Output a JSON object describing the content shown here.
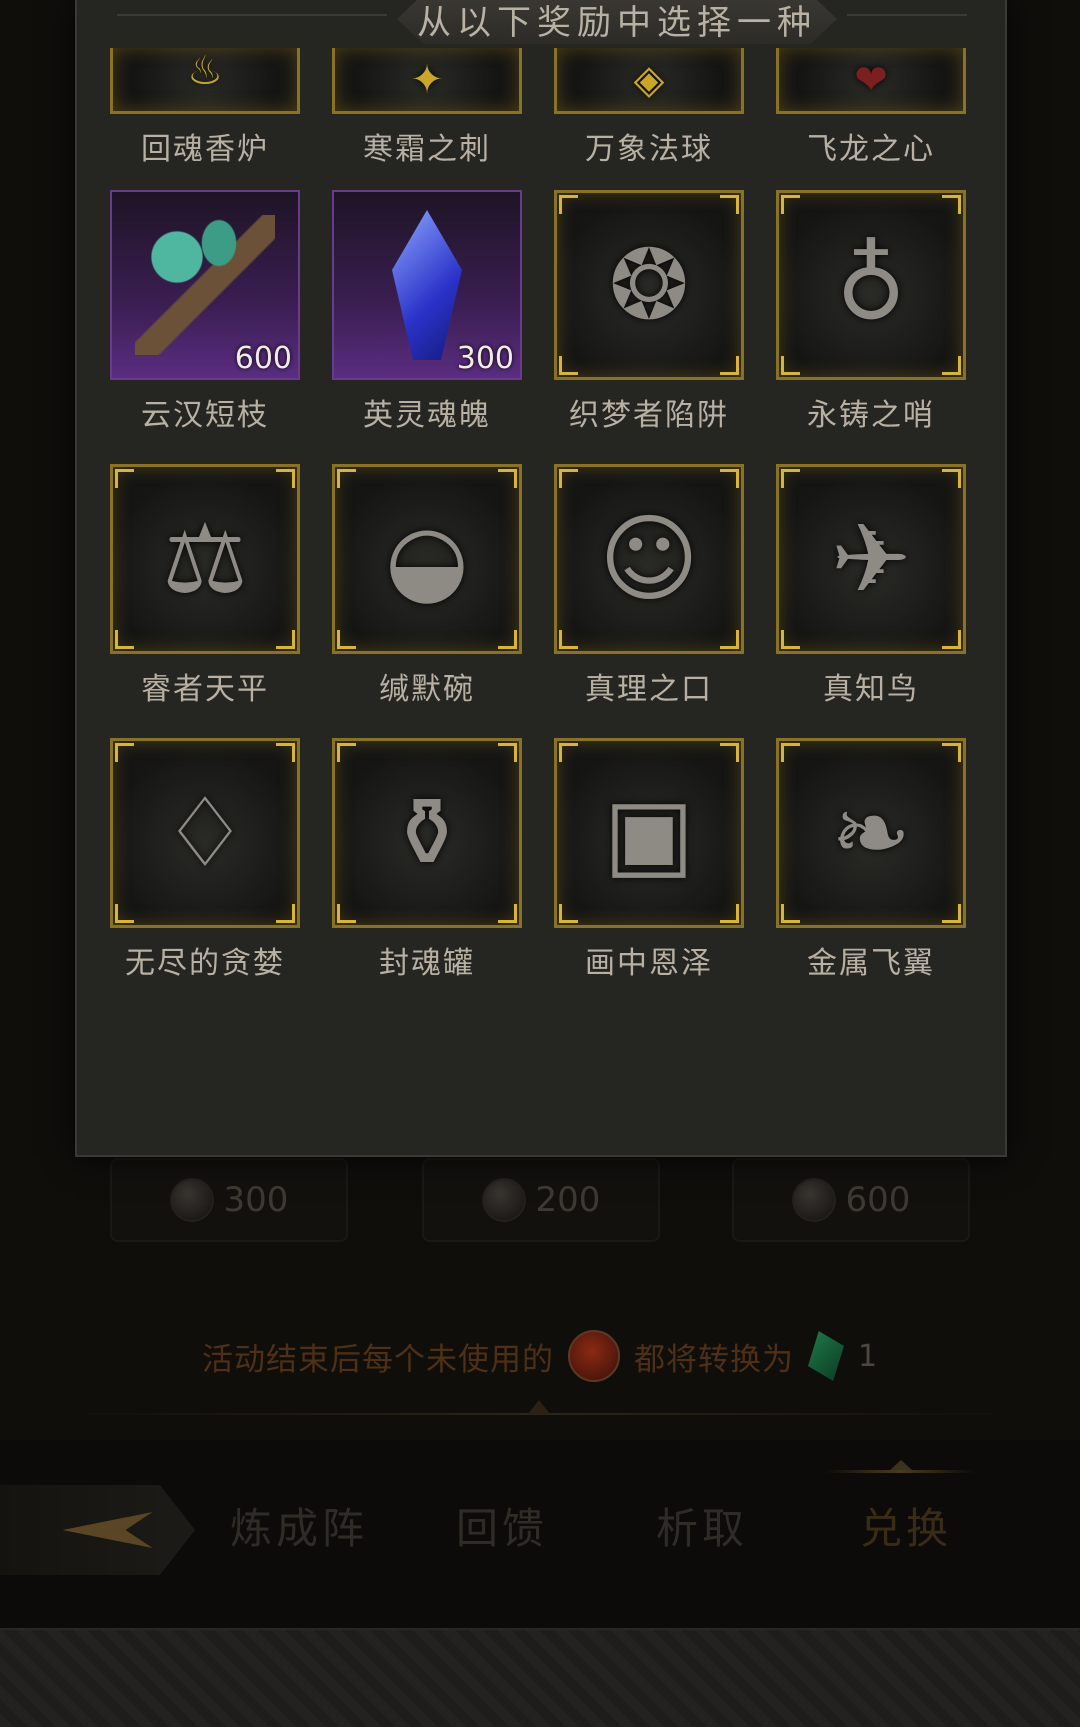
{
  "modal": {
    "title": "从以下奖励中选择一种",
    "items": [
      {
        "label": "回魂香炉",
        "icon": "incense-burner-icon",
        "qty": ""
      },
      {
        "label": "寒霜之刺",
        "icon": "frost-thorn-icon",
        "qty": ""
      },
      {
        "label": "万象法球",
        "icon": "orb-icon",
        "qty": ""
      },
      {
        "label": "飞龙之心",
        "icon": "dragon-heart-icon",
        "qty": ""
      },
      {
        "label": "云汉短枝",
        "icon": "branch-icon",
        "qty": "600"
      },
      {
        "label": "英灵魂魄",
        "icon": "soul-crystal-icon",
        "qty": "300"
      },
      {
        "label": "织梦者陷阱",
        "icon": "dreamcatcher-icon",
        "qty": ""
      },
      {
        "label": "永铸之哨",
        "icon": "whistle-icon",
        "qty": ""
      },
      {
        "label": "睿者天平",
        "icon": "scales-icon",
        "qty": ""
      },
      {
        "label": "缄默碗",
        "icon": "bowl-icon",
        "qty": ""
      },
      {
        "label": "真理之口",
        "icon": "mouth-of-truth-icon",
        "qty": ""
      },
      {
        "label": "真知鸟",
        "icon": "bird-icon",
        "qty": ""
      },
      {
        "label": "无尽的贪婪",
        "icon": "pouch-icon",
        "qty": ""
      },
      {
        "label": "封魂罐",
        "icon": "urn-icon",
        "qty": ""
      },
      {
        "label": "画中恩泽",
        "icon": "framed-painting-icon",
        "qty": ""
      },
      {
        "label": "金属飞翼",
        "icon": "metal-wing-icon",
        "qty": ""
      }
    ]
  },
  "prices": [
    "300",
    "200",
    "600"
  ],
  "notice": {
    "text_before": "活动结束后每个未使用的",
    "text_after": "都将转换为",
    "count": "1"
  },
  "tabs": {
    "items": [
      "炼成阵",
      "回馈",
      "析取",
      "兑换"
    ],
    "active": "兑换"
  },
  "colors": {
    "gold_frame": "#8a7224",
    "purple_frame": "#6a3b8c",
    "modal_bg": "#252521",
    "label_text": "#b8b1a3"
  }
}
